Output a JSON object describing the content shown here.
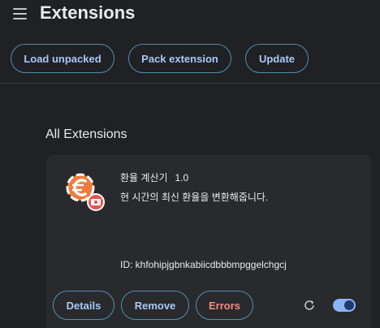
{
  "header": {
    "title": "Extensions"
  },
  "toolbar": {
    "load_unpacked": "Load unpacked",
    "pack_extension": "Pack extension",
    "update": "Update"
  },
  "section": {
    "title": "All Extensions"
  },
  "extension": {
    "name": "환율 계산기",
    "version": "1.0",
    "description": "현 시간의 최신 환율을 변환해줍니다.",
    "id_text": "ID: khfohipjgbnkabiicdbbbmpggelchgcj",
    "details_label": "Details",
    "remove_label": "Remove",
    "errors_label": "Errors",
    "enabled": true
  },
  "colors": {
    "accent": "#a8c7fa",
    "error": "#f28b82",
    "toggle_on": "#8ab4f8",
    "icon_orange": "#f07a3a",
    "icon_red": "#e8554f"
  }
}
